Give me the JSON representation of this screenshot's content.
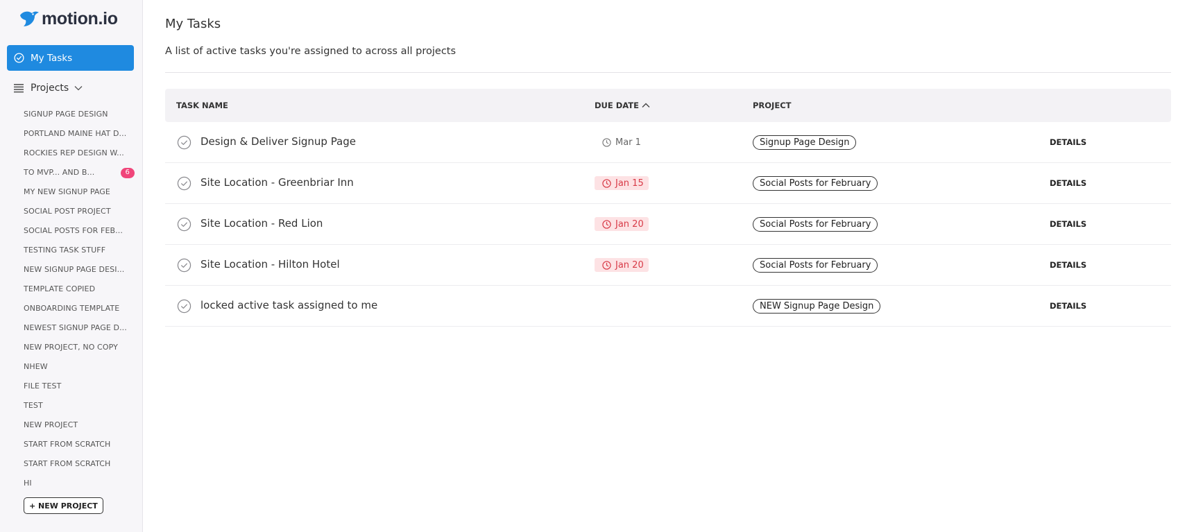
{
  "app": {
    "logo_text": "motion.io"
  },
  "sidebar": {
    "my_tasks_label": "My Tasks",
    "projects_label": "Projects",
    "projects": [
      {
        "label": "SIGNUP PAGE DESIGN"
      },
      {
        "label": "PORTLAND MAINE HAT D..."
      },
      {
        "label": "ROCKIES REP DESIGN W..."
      },
      {
        "label": "TO MVP... AND B...",
        "badge": "6"
      },
      {
        "label": "MY NEW SIGNUP PAGE"
      },
      {
        "label": "SOCIAL POST PROJECT"
      },
      {
        "label": "SOCIAL POSTS FOR FEB..."
      },
      {
        "label": "TESTING TASK STUFF"
      },
      {
        "label": "NEW SIGNUP PAGE DESI..."
      },
      {
        "label": "TEMPLATE COPIED"
      },
      {
        "label": "ONBOARDING TEMPLATE"
      },
      {
        "label": "NEWEST SIGNUP PAGE D..."
      },
      {
        "label": "NEW PROJECT, NO COPY"
      },
      {
        "label": "NHEW"
      },
      {
        "label": "FILE TEST"
      },
      {
        "label": "TEST"
      },
      {
        "label": "NEW PROJECT"
      },
      {
        "label": "START FROM SCRATCH"
      },
      {
        "label": "START FROM SCRATCH"
      },
      {
        "label": "HI"
      }
    ],
    "new_project_label": "+ NEW PROJECT"
  },
  "main": {
    "title": "My Tasks",
    "subtitle": "A list of active tasks you're assigned to across all projects",
    "columns": {
      "task_name": "TASK NAME",
      "due_date": "DUE DATE",
      "project": "PROJECT"
    },
    "tasks": [
      {
        "name": "Design & Deliver Signup Page",
        "due": "Mar 1",
        "overdue": false,
        "project": "Signup Page Design",
        "action": "DETAILS"
      },
      {
        "name": "Site Location - Greenbriar Inn",
        "due": "Jan 15",
        "overdue": true,
        "project": "Social Posts for February",
        "action": "DETAILS"
      },
      {
        "name": "Site Location - Red Lion",
        "due": "Jan 20",
        "overdue": true,
        "project": "Social Posts for February",
        "action": "DETAILS"
      },
      {
        "name": "Site Location - Hilton Hotel",
        "due": "Jan 20",
        "overdue": true,
        "project": "Social Posts for February",
        "action": "DETAILS"
      },
      {
        "name": "locked active task assigned to me",
        "due": "",
        "overdue": false,
        "project": "NEW Signup Page Design",
        "action": "DETAILS"
      }
    ]
  },
  "colors": {
    "accent": "#1f8ae0",
    "badge": "#f0457a",
    "overdue_bg": "#fde2e4",
    "overdue_text": "#d83a47"
  },
  "icons": {
    "logo": "bird-logo-icon",
    "my_tasks": "check-circle-icon",
    "projects": "list-icon",
    "sort": "chevron-up-icon",
    "due": "clock-icon",
    "task_check": "check-circle-icon"
  }
}
